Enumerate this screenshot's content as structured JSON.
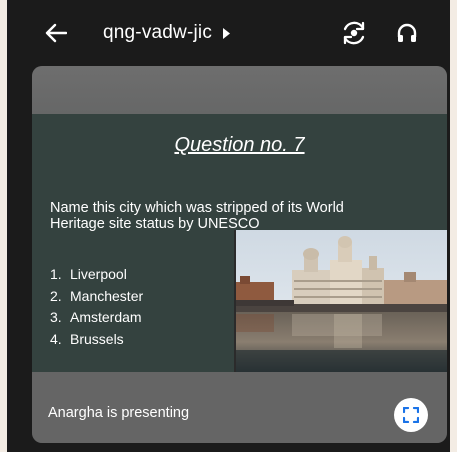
{
  "header": {
    "meeting_code": "qng-vadw-jic",
    "icons": {
      "back": "arrow-left-icon",
      "caret": "caret-right-icon",
      "switch_camera": "switch-camera-icon",
      "audio": "headphones-icon"
    }
  },
  "slide": {
    "title": "Question no. 7",
    "question": "Name this city which was stripped of its World Heritage site status by UNESCO",
    "options": [
      {
        "num": "1.",
        "text": "Liverpool"
      },
      {
        "num": "2.",
        "text": "Manchester"
      },
      {
        "num": "3.",
        "text": "Amsterdam"
      },
      {
        "num": "4.",
        "text": "Brussels"
      }
    ]
  },
  "footer": {
    "presenting_text": "Anargha is presenting",
    "fullscreen_icon": "fullscreen-icon"
  },
  "colors": {
    "app_bg": "#1b1b1b",
    "slide_bg": "#34423f",
    "accent": "#1a73e8"
  }
}
